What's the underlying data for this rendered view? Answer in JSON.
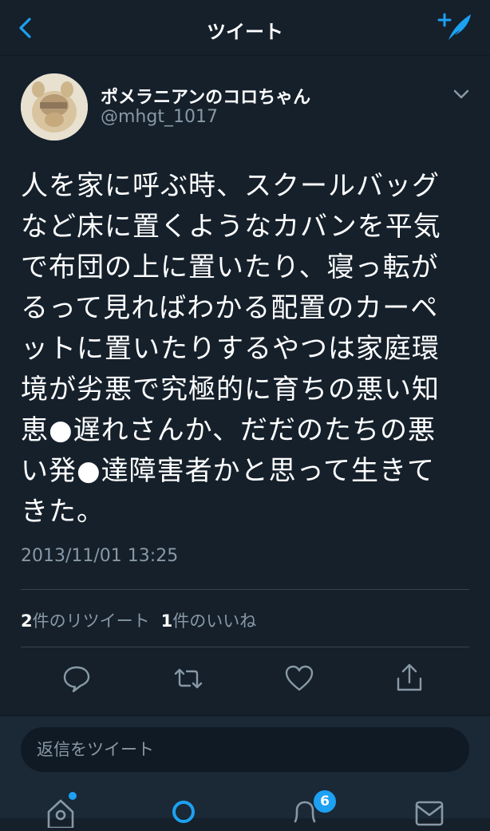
{
  "header": {
    "title": "ツイート",
    "back_icon": "chevron-left-icon",
    "compose_icon": "compose-tweet-icon"
  },
  "tweet": {
    "author_name": "ポメラニアンのコロちゃん",
    "author_handle": "@mhgt_1017",
    "text": "人を家に呼ぶ時、スクールバッグ\nなど床に置くようなカバンを平気\nで布団の上に置いたり、寝っ転が\nるって見ればわかる配置のカーペ\nットに置いたりするやつは家庭環\n境が劣悪で究極的に育ちの悪い知\n恵●遅れさんか、だだのたちの悪\nい発●達障害者かと思って生きて\nきた。",
    "timestamp": "2013/11/01 13:25",
    "retweet_count": "2",
    "retweet_label": "件のリツイート",
    "like_count": "1",
    "like_label": "件のいいね"
  },
  "actions": {
    "reply_icon": "reply-icon",
    "retweet_icon": "retweet-icon",
    "like_icon": "heart-icon",
    "share_icon": "share-icon"
  },
  "reply_bar": {
    "placeholder": "返信をツイート"
  },
  "tabbar": {
    "notifications_badge": "6"
  },
  "colors": {
    "background": "#15202b",
    "accent": "#1da1f2",
    "secondary_text": "#8899a6",
    "divider": "#38444d"
  }
}
